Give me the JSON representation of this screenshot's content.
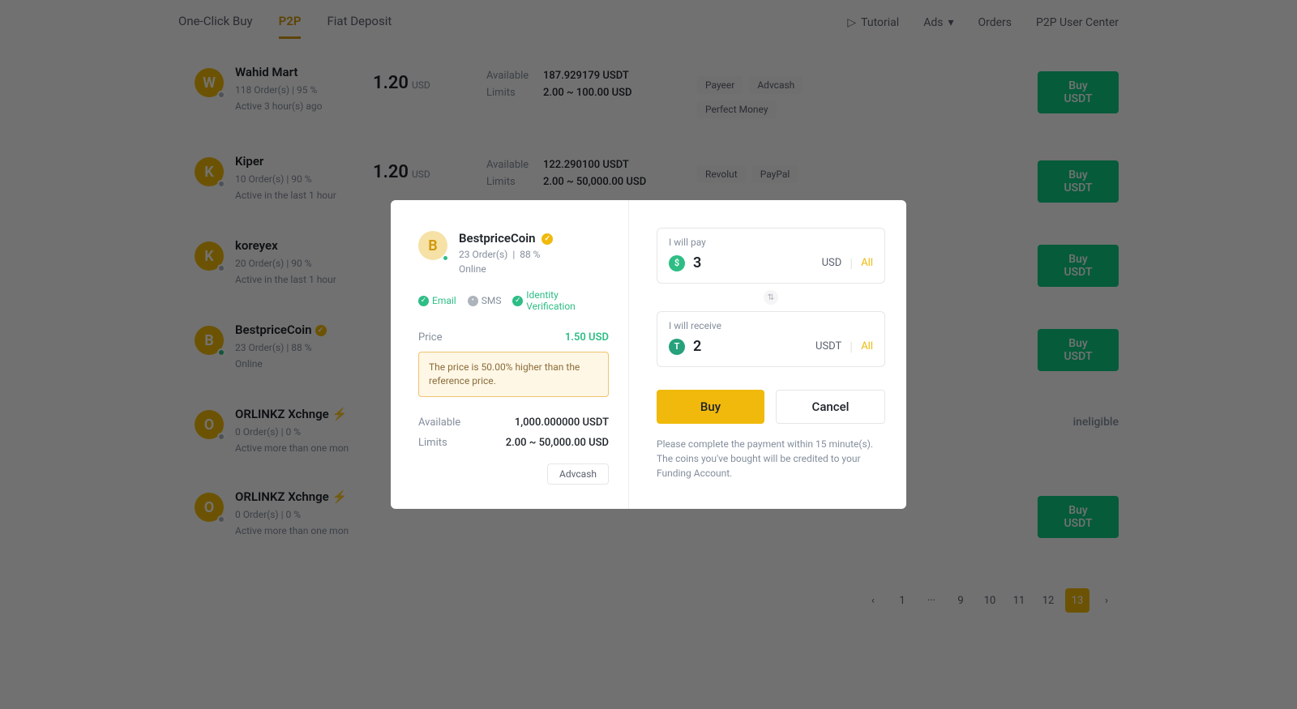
{
  "nav": {
    "left": [
      "One-Click Buy",
      "P2P",
      "Fiat Deposit"
    ],
    "active_index": 1,
    "right": {
      "tutorial": "Tutorial",
      "ads": "Ads",
      "orders": "Orders",
      "user_center": "P2P User Center"
    }
  },
  "button_labels": {
    "buy": "Buy USDT",
    "ineligible": "ineligible"
  },
  "limit_labels": {
    "available": "Available",
    "limits": "Limits"
  },
  "sellers": [
    {
      "initial": "W",
      "name": "Wahid Mart",
      "orders": "118 Order(s)",
      "rate": "95 %",
      "status": "Active 3 hour(s) ago",
      "price": "1.20",
      "unit": "USD",
      "available": "187.929179 USDT",
      "limits": "2.00 ~ 100.00 USD",
      "payments": [
        "Payeer",
        "Advcash",
        "Perfect Money"
      ],
      "action": "buy",
      "online": false
    },
    {
      "initial": "K",
      "name": "Kiper",
      "orders": "10 Order(s)",
      "rate": "90 %",
      "status": "Active in the last 1 hour",
      "price": "1.20",
      "unit": "USD",
      "available": "122.290100 USDT",
      "limits": "2.00 ~ 50,000.00 USD",
      "payments": [
        "Revolut",
        "PayPal"
      ],
      "action": "buy",
      "online": false
    },
    {
      "initial": "K",
      "name": "koreyex",
      "orders": "20 Order(s)",
      "rate": "90 %",
      "status": "Active in the last 1 hour",
      "price": "",
      "unit": "",
      "available": "",
      "limits": "",
      "payments": [],
      "action": "buy",
      "online": false
    },
    {
      "initial": "B",
      "name": "BestpriceCoin",
      "verified": true,
      "orders": "23 Order(s)",
      "rate": "88 %",
      "status": "Online",
      "price": "",
      "unit": "",
      "available": "",
      "limits": "",
      "payments": [],
      "action": "buy",
      "online": true
    },
    {
      "initial": "O",
      "name": "ORLINKZ Xchnge",
      "bolt": true,
      "orders": "0 Order(s)",
      "rate": "0 %",
      "status": "Active more than one mon",
      "price": "",
      "unit": "",
      "available": "",
      "limits": "",
      "payments": [],
      "action": "ineligible",
      "online": false
    },
    {
      "initial": "O",
      "name": "ORLINKZ Xchnge",
      "bolt": true,
      "orders": "0 Order(s)",
      "rate": "0 %",
      "status": "Active more than one mon",
      "price": "",
      "unit": "",
      "available": "",
      "limits": "",
      "payments": [],
      "action": "buy",
      "online": false
    }
  ],
  "pagination": {
    "pages": [
      "‹",
      "1",
      "···",
      "9",
      "10",
      "11",
      "12",
      "13",
      "›"
    ],
    "active": "13"
  },
  "modal": {
    "seller": {
      "initial": "B",
      "name": "BestpriceCoin",
      "orders": "23 Order(s)",
      "rate": "88 %",
      "status": "Online"
    },
    "verif": {
      "email": "Email",
      "sms": "SMS",
      "identity": "Identity Verification"
    },
    "kv": {
      "price_label": "Price",
      "price_value": "1.50 USD",
      "warning": "The price is 50.00% higher than the reference price.",
      "avail_label": "Available",
      "avail_value": "1,000.000000 USDT",
      "limits_label": "Limits",
      "limits_value": "2.00 ~ 50,000.00 USD",
      "payment_chip": "Advcash"
    },
    "pay": {
      "label": "I will pay",
      "value": "3",
      "unit": "USD",
      "all": "All"
    },
    "receive": {
      "label": "I will receive",
      "value": "2",
      "unit": "USDT",
      "all": "All"
    },
    "actions": {
      "buy": "Buy",
      "cancel": "Cancel"
    },
    "note": "Please complete the payment within 15 minute(s). The coins you've bought will be credited to your Funding Account."
  }
}
